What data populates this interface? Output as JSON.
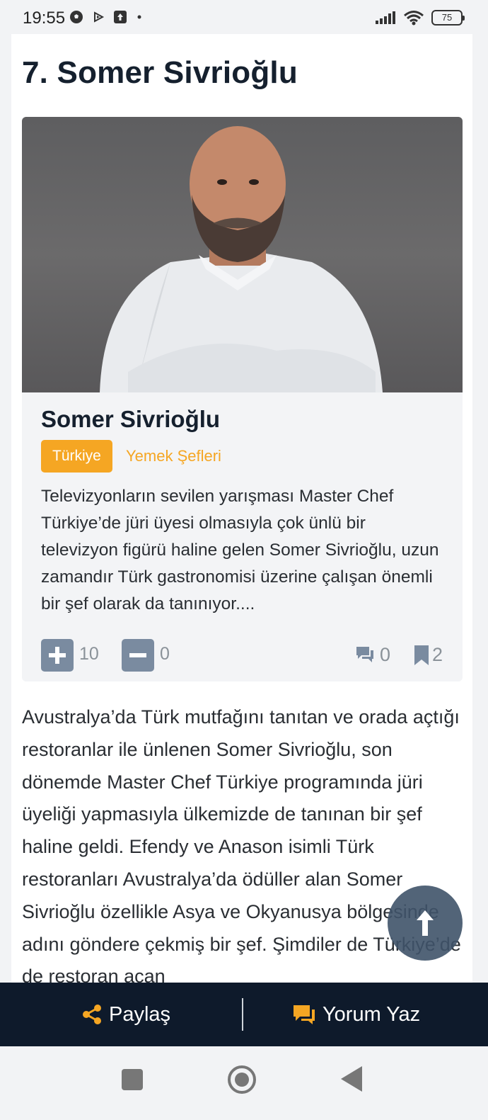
{
  "status_bar": {
    "time": "19:55",
    "battery": "75"
  },
  "article": {
    "item_title": "7. Somer Sivrioğlu",
    "card": {
      "name": "Somer Sivrioğlu",
      "country_tag": "Türkiye",
      "category_tag": "Yemek Şefleri",
      "description": "Televizyonların sevilen yarışması Master Chef Türkiye’de jüri üyesi olmasıyla çok ünlü bir televizyon figürü haline gelen Somer Sivrioğlu, uzun zamandır Türk gastronomisi üzerine çalışan önemli bir şef olarak da tanınıyor....",
      "upvotes": "10",
      "downvotes": "0",
      "comments": "0",
      "bookmarks": "2"
    },
    "body": "Avustralya’da Türk mutfağını tanıtan ve orada açtığı restoranlar ile ünlenen Somer Sivrioğlu, son dönemde Master Chef Türkiye programında jüri üyeliği yapmasıyla ülkemizde de tanınan bir şef haline geldi. Efendy ve Anason isimli Türk restoranları Avustralya’da ödüller alan Somer Sivrioğlu özellikle Asya ve Okyanusya bölgesinde adını göndere çekmiş bir şef. Şimdiler de Türkiye’de de restoran açan"
  },
  "action_bar": {
    "share_label": "Paylaş",
    "comment_label": "Yorum Yaz"
  },
  "colors": {
    "accent": "#f5a623",
    "navy": "#0e1a2b"
  }
}
